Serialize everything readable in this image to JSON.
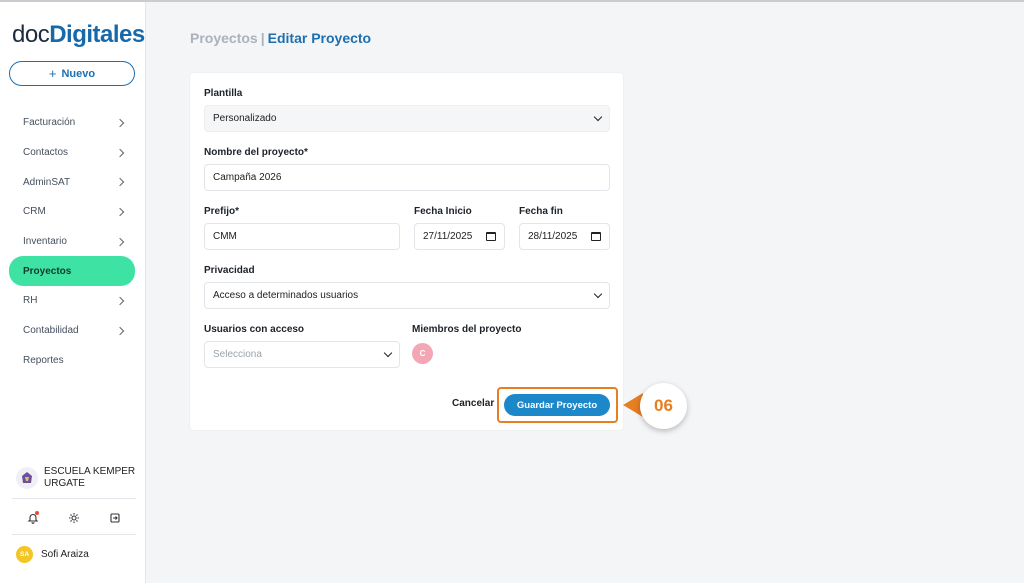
{
  "brand": {
    "part1": "doc",
    "part2": "Digitales"
  },
  "sidebar": {
    "new_button": "Nuevo",
    "items": [
      {
        "label": "Facturación",
        "has_chevron": true
      },
      {
        "label": "Contactos",
        "has_chevron": true
      },
      {
        "label": "AdminSAT",
        "has_chevron": true
      },
      {
        "label": "CRM",
        "has_chevron": true
      },
      {
        "label": "Inventario",
        "has_chevron": true
      },
      {
        "label": "Proyectos",
        "has_chevron": false,
        "active": true
      },
      {
        "label": "RH",
        "has_chevron": true
      },
      {
        "label": "Contabilidad",
        "has_chevron": true
      },
      {
        "label": "Reportes",
        "has_chevron": false
      }
    ],
    "org_name_line1": "ESCUELA KEMPER",
    "org_name_line2": "URGATE",
    "footer_icons": [
      "bell-icon",
      "gear-icon",
      "logout-icon"
    ],
    "user": {
      "initials": "SA",
      "name": "Sofi Araiza"
    }
  },
  "breadcrumb": {
    "parent": "Proyectos",
    "separator": "|",
    "current": "Editar Proyecto"
  },
  "form": {
    "plantilla_label": "Plantilla",
    "plantilla_value": "Personalizado",
    "nombre_label": "Nombre del proyecto*",
    "nombre_value": "Campaña 2026",
    "prefijo_label": "Prefijo*",
    "prefijo_value": "CMM",
    "fecha_inicio_label": "Fecha Inicio",
    "fecha_inicio_value": "27/11/2025",
    "fecha_fin_label": "Fecha fin",
    "fecha_fin_value": "28/11/2025",
    "privacidad_label": "Privacidad",
    "privacidad_value": "Acceso a determinados usuarios",
    "usuarios_label": "Usuarios con acceso",
    "usuarios_placeholder": "Selecciona",
    "miembros_label": "Miembros del proyecto",
    "member_initial": "C",
    "cancel_label": "Cancelar",
    "save_label": "Guardar Proyecto"
  },
  "step_badge": "06",
  "colors": {
    "accent": "#1f6fb0",
    "active_nav": "#3ee3a4",
    "highlight": "#e67e22",
    "save_button": "#1c87c9"
  }
}
